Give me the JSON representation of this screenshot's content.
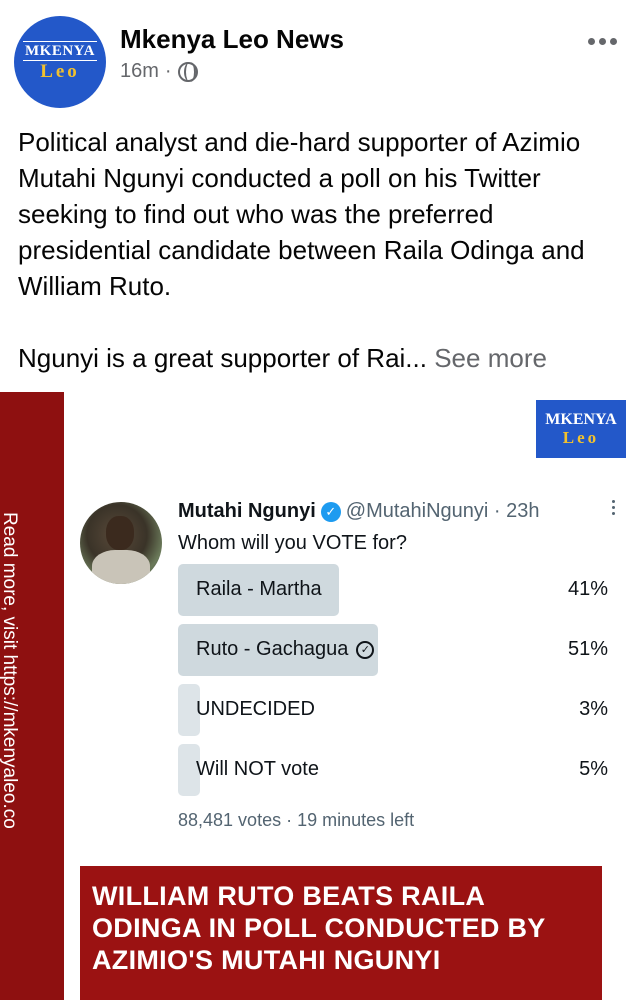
{
  "post": {
    "page_name": "Mkenya Leo News",
    "time": "16m",
    "separator": "·",
    "avatar_logo": {
      "line1": "MKENYA",
      "line2": "Leo"
    },
    "text_paragraph_1": "Political analyst and die-hard supporter of Azimio Mutahi Ngunyi conducted a poll on his Twitter seeking to find out who was the preferred presidential candidate between Raila Odinga and William Ruto.",
    "text_paragraph_2": "Ngunyi is a great supporter of Rai...",
    "see_more": "See more",
    "icons": {
      "privacy": "globe-icon",
      "menu": "more-icon"
    }
  },
  "image": {
    "side_text": "Read more, visit https://mkenyaleo.co",
    "brand": {
      "line1": "MKENYA",
      "line2": "Leo"
    },
    "tweet": {
      "name": "Mutahi Ngunyi",
      "handle": "@MutahiNgunyi · 23h",
      "question": "Whom will you VOTE for?",
      "poll": [
        {
          "label": "Raila - Martha",
          "percent": "41%",
          "value": 41,
          "winner": false
        },
        {
          "label": "Ruto - Gachagua",
          "percent": "51%",
          "value": 51,
          "winner": true
        },
        {
          "label": "UNDECIDED",
          "percent": "3%",
          "value": 3,
          "winner": false
        },
        {
          "label": "Will NOT vote",
          "percent": "5%",
          "value": 5,
          "winner": false
        }
      ],
      "footer": "88,481 votes · 19 minutes left"
    },
    "headline": "WILLIAM RUTO BEATS RAILA ODINGA IN POLL CONDUCTED BY AZIMIO'S MUTAHI NGUNYI",
    "colors": {
      "brand_blue": "#2358c9",
      "banner_red": "#9b1212",
      "sidebar_red": "#8e1010",
      "poll_fill": "#cfd9de"
    }
  }
}
